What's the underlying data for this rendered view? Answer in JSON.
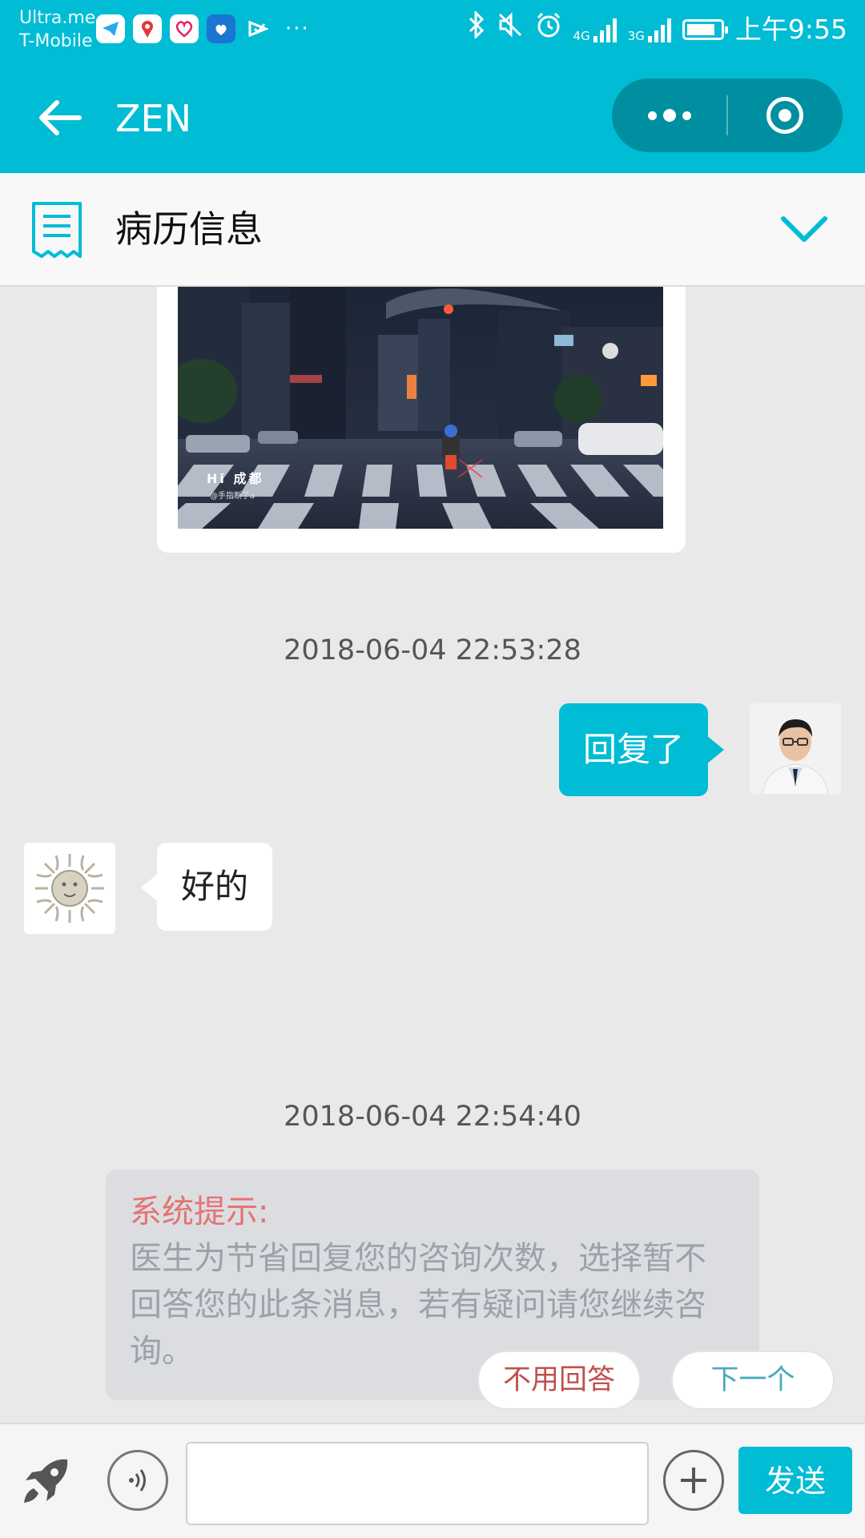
{
  "status_bar": {
    "carrier_line1": "Ultra.me",
    "carrier_line2": "T-Mobile",
    "overflow": "···",
    "net1": "4G",
    "net2": "3G",
    "time": "上午9:55",
    "battery_level": 0.85,
    "icons": [
      "telegram-icon",
      "maps-icon",
      "health-icon",
      "baidu-icon",
      "check-icon",
      "bluetooth-icon",
      "mute-icon",
      "alarm-icon",
      "signal-icon",
      "battery-icon"
    ]
  },
  "titlebar": {
    "title": "ZEN",
    "back_icon": "arrow-left-icon",
    "menu_icon": "more-dots-icon",
    "close_icon": "target-circle-icon"
  },
  "record": {
    "title": "病历信息",
    "icon": "receipt-icon",
    "toggle_icon": "chevron-down-icon"
  },
  "messages": {
    "image_card": {
      "caption": "Hi 成都",
      "sub_caption": "@手指断了a"
    },
    "timestamp1": "2018-06-04 22:53:28",
    "outgoing_text": "回复了",
    "incoming_text": "好的",
    "timestamp2": "2018-06-04 22:54:40",
    "system_tip": {
      "title": "系统提示:",
      "body": "医生为节省回复您的咨询次数，选择暂不回答您的此条消息，若有疑问请您继续咨询。"
    }
  },
  "actions": {
    "no_reply": "不用回答",
    "next": "下一个"
  },
  "input_bar": {
    "input_value": "",
    "send_label": "发送"
  },
  "colors": {
    "accent": "#00bcd4",
    "accent_dark": "#008fa0",
    "system_title": "#e57373",
    "system_body": "#9aa2ac",
    "no_reply_text": "#c0504d",
    "next_text": "#4aa8bd"
  }
}
